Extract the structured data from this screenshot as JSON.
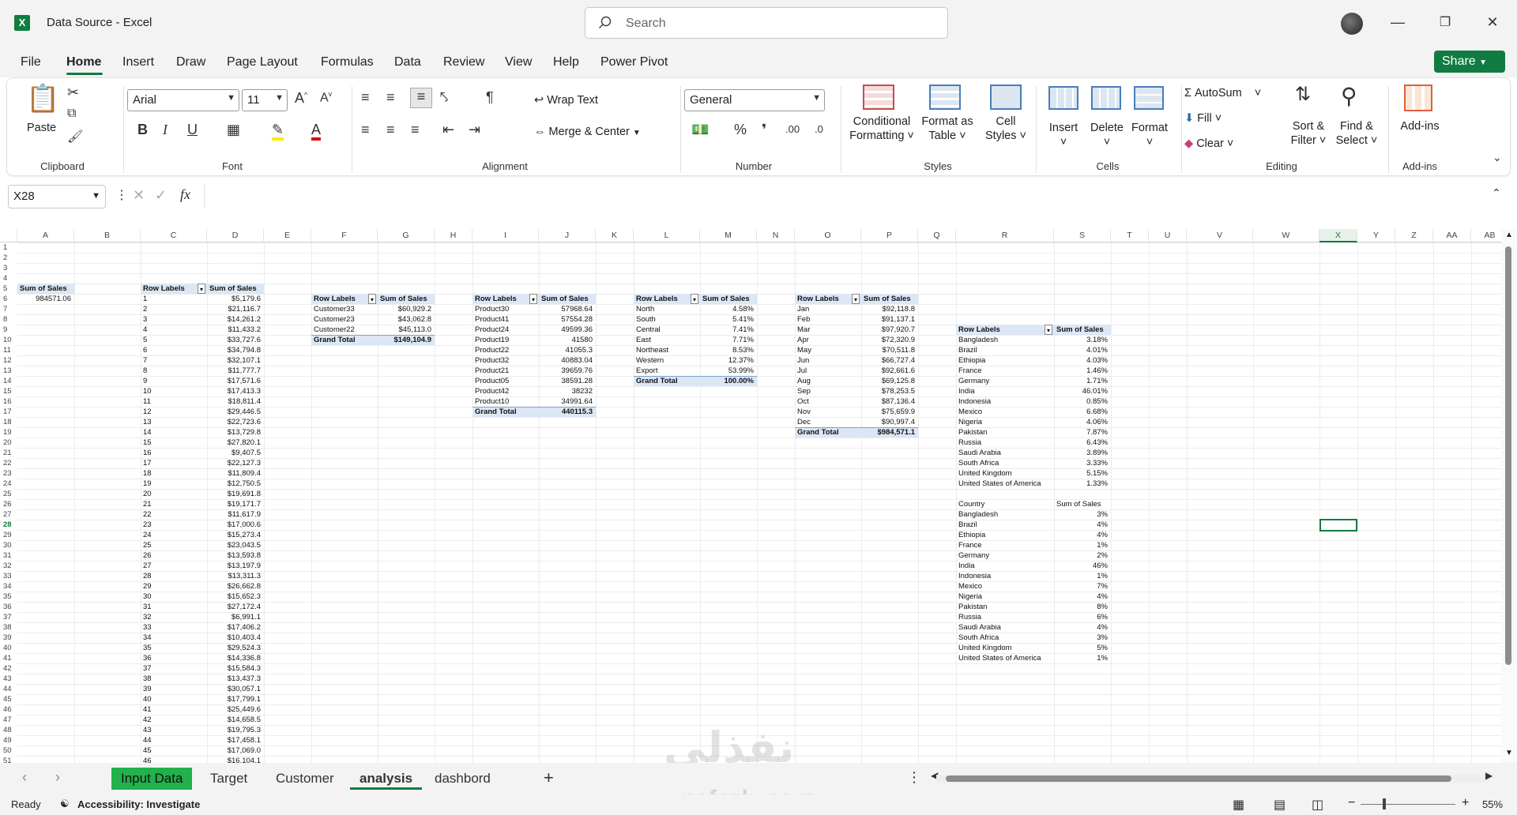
{
  "window": {
    "title": "Data Source  -  Excel",
    "search_placeholder": "Search"
  },
  "menu": {
    "tabs": [
      "File",
      "Home",
      "Insert",
      "Draw",
      "Page Layout",
      "Formulas",
      "Data",
      "Review",
      "View",
      "Help",
      "Power Pivot"
    ],
    "active": "Home",
    "share_label": "Share"
  },
  "ribbon": {
    "clipboard": {
      "paste": "Paste",
      "label": "Clipboard"
    },
    "font": {
      "name": "Arial",
      "size": "11",
      "label": "Font"
    },
    "alignment": {
      "wrap": "Wrap Text",
      "merge": "Merge & Center",
      "label": "Alignment"
    },
    "number": {
      "format": "General",
      "label": "Number"
    },
    "styles": {
      "conditional": "Conditional",
      "formatting": "Formatting",
      "format_as": "Format as",
      "table": "Table",
      "cell": "Cell",
      "cell_styles": "Styles",
      "label": "Styles"
    },
    "cells": {
      "insert": "Insert",
      "delete": "Delete",
      "format": "Format",
      "label": "Cells"
    },
    "editing": {
      "autosum": "AutoSum",
      "fill": "Fill",
      "clear": "Clear",
      "sort": "Sort &",
      "filter": "Filter",
      "find": "Find &",
      "select": "Select",
      "label": "Editing"
    },
    "addins": {
      "label_btn": "Add-ins",
      "label": "Add-ins"
    }
  },
  "formula_bar": {
    "name_box": "X28",
    "fx": "fx",
    "content": ""
  },
  "columns": [
    "A",
    "B",
    "C",
    "D",
    "E",
    "F",
    "G",
    "H",
    "I",
    "J",
    "K",
    "L",
    "M",
    "N",
    "O",
    "P",
    "Q",
    "R",
    "S",
    "T",
    "U",
    "V",
    "W",
    "X",
    "Y",
    "Z",
    "AA",
    "AB"
  ],
  "selected_cell": "X28",
  "pivot_a": {
    "header": "Sum of Sales",
    "value": "984571.06"
  },
  "pivot_c": {
    "h1": "Row Labels",
    "h2": "Sum of Sales",
    "rows": [
      [
        "1",
        "$5,179.6"
      ],
      [
        "2",
        "$21,116.7"
      ],
      [
        "3",
        "$14,261.2"
      ],
      [
        "4",
        "$11,433.2"
      ],
      [
        "5",
        "$33,727.6"
      ],
      [
        "6",
        "$34,794.8"
      ],
      [
        "7",
        "$32,107.1"
      ],
      [
        "8",
        "$11,777.7"
      ],
      [
        "9",
        "$17,571.6"
      ],
      [
        "10",
        "$17,413.3"
      ],
      [
        "11",
        "$18,811.4"
      ],
      [
        "12",
        "$29,446.5"
      ],
      [
        "13",
        "$22,723.6"
      ],
      [
        "14",
        "$13,729.8"
      ],
      [
        "15",
        "$27,820.1"
      ],
      [
        "16",
        "$9,407.5"
      ],
      [
        "17",
        "$22,127.3"
      ],
      [
        "18",
        "$11,809.4"
      ],
      [
        "19",
        "$12,750.5"
      ],
      [
        "20",
        "$19,691.8"
      ],
      [
        "21",
        "$19,171.7"
      ],
      [
        "22",
        "$11,617.9"
      ],
      [
        "23",
        "$17,000.6"
      ],
      [
        "24",
        "$15,273.4"
      ],
      [
        "25",
        "$23,043.5"
      ],
      [
        "26",
        "$13,593.8"
      ],
      [
        "27",
        "$13,197.9"
      ],
      [
        "28",
        "$13,311.3"
      ],
      [
        "29",
        "$26,662.8"
      ],
      [
        "30",
        "$15,652.3"
      ],
      [
        "31",
        "$27,172.4"
      ],
      [
        "32",
        "$6,991.1"
      ],
      [
        "33",
        "$17,406.2"
      ],
      [
        "34",
        "$10,403.4"
      ],
      [
        "35",
        "$29,524.3"
      ],
      [
        "36",
        "$14,336.8"
      ],
      [
        "37",
        "$15,584.3"
      ],
      [
        "38",
        "$13,437.3"
      ],
      [
        "39",
        "$30,057.1"
      ],
      [
        "40",
        "$17,799.1"
      ],
      [
        "41",
        "$25,449.6"
      ],
      [
        "42",
        "$14,658.5"
      ],
      [
        "43",
        "$19,795.3"
      ],
      [
        "44",
        "$17,458.1"
      ],
      [
        "45",
        "$17,069.0"
      ],
      [
        "46",
        "$16,104.1"
      ]
    ]
  },
  "pivot_f": {
    "h1": "Row Labels",
    "h2": "Sum of Sales",
    "rows": [
      [
        "Customer33",
        "$60,929.2"
      ],
      [
        "Customer23",
        "$43,062.8"
      ],
      [
        "Customer22",
        "$45,113.0"
      ]
    ],
    "total": [
      "Grand Total",
      "$149,104.9"
    ]
  },
  "pivot_i": {
    "h1": "Row Labels",
    "h2": "Sum of Sales",
    "rows": [
      [
        "Product30",
        "57968.64"
      ],
      [
        "Product41",
        "57554.28"
      ],
      [
        "Product24",
        "49599.36"
      ],
      [
        "Product19",
        "41580"
      ],
      [
        "Product22",
        "41055.3"
      ],
      [
        "Product32",
        "40883.04"
      ],
      [
        "Product21",
        "39659.76"
      ],
      [
        "Product05",
        "38591.28"
      ],
      [
        "Product42",
        "38232"
      ],
      [
        "Product10",
        "34991.64"
      ]
    ],
    "total": [
      "Grand Total",
      "440115.3"
    ]
  },
  "pivot_l": {
    "h1": "Row Labels",
    "h2": "Sum of Sales",
    "rows": [
      [
        "North",
        "4.58%"
      ],
      [
        "South",
        "5.41%"
      ],
      [
        "Central",
        "7.41%"
      ],
      [
        "East",
        "7.71%"
      ],
      [
        "Northeast",
        "8.53%"
      ],
      [
        "Western",
        "12.37%"
      ],
      [
        "Export",
        "53.99%"
      ]
    ],
    "total": [
      "Grand Total",
      "100.00%"
    ]
  },
  "pivot_o": {
    "h1": "Row Labels",
    "h2": "Sum of Sales",
    "rows": [
      [
        "Jan",
        "$92,118.8"
      ],
      [
        "Feb",
        "$91,137.1"
      ],
      [
        "Mar",
        "$97,920.7"
      ],
      [
        "Apr",
        "$72,320.9"
      ],
      [
        "May",
        "$70,511.8"
      ],
      [
        "Jun",
        "$66,727.4"
      ],
      [
        "Jul",
        "$92,661.6"
      ],
      [
        "Aug",
        "$69,125.8"
      ],
      [
        "Sep",
        "$78,253.5"
      ],
      [
        "Oct",
        "$87,136.4"
      ],
      [
        "Nov",
        "$75,659.9"
      ],
      [
        "Dec",
        "$90,997.4"
      ]
    ],
    "total": [
      "Grand Total",
      "$984,571.1"
    ]
  },
  "pivot_r": {
    "h1": "Row Labels",
    "h2": "Sum of Sales",
    "rows": [
      [
        "Bangladesh",
        "3.18%"
      ],
      [
        "Brazil",
        "4.01%"
      ],
      [
        "Ethiopia",
        "4.03%"
      ],
      [
        "France",
        "1.46%"
      ],
      [
        "Germany",
        "1.71%"
      ],
      [
        "India",
        "46.01%"
      ],
      [
        "Indonesia",
        "0.85%"
      ],
      [
        "Mexico",
        "6.68%"
      ],
      [
        "Nigeria",
        "4.06%"
      ],
      [
        "Pakistan",
        "7.87%"
      ],
      [
        "Russia",
        "6.43%"
      ],
      [
        "Saudi Arabia",
        "3.89%"
      ],
      [
        "South Africa",
        "3.33%"
      ],
      [
        "United Kingdom",
        "5.15%"
      ],
      [
        "United States of America",
        "1.33%"
      ]
    ]
  },
  "table_r2": {
    "h1": "Country",
    "h2": "Sum of Sales",
    "rows": [
      [
        "Bangladesh",
        "3%"
      ],
      [
        "Brazil",
        "4%"
      ],
      [
        "Ethiopia",
        "4%"
      ],
      [
        "France",
        "1%"
      ],
      [
        "Germany",
        "2%"
      ],
      [
        "India",
        "46%"
      ],
      [
        "Indonesia",
        "1%"
      ],
      [
        "Mexico",
        "7%"
      ],
      [
        "Nigeria",
        "4%"
      ],
      [
        "Pakistan",
        "8%"
      ],
      [
        "Russia",
        "6%"
      ],
      [
        "Saudi Arabia",
        "4%"
      ],
      [
        "South Africa",
        "3%"
      ],
      [
        "United Kingdom",
        "5%"
      ],
      [
        "United States of America",
        "1%"
      ]
    ]
  },
  "sheets": [
    "Input Data",
    "Target",
    "Customer",
    "analysis",
    "dashbord"
  ],
  "active_sheet": "analysis",
  "status": {
    "ready": "Ready",
    "accessibility": "Accessibility: Investigate",
    "zoom": "55%"
  },
  "watermark": {
    "line1": "نفذلي",
    "line2": "nafezly.com"
  },
  "colors": {
    "accent": "#107c41",
    "pivot_header": "#dbe7f5"
  }
}
